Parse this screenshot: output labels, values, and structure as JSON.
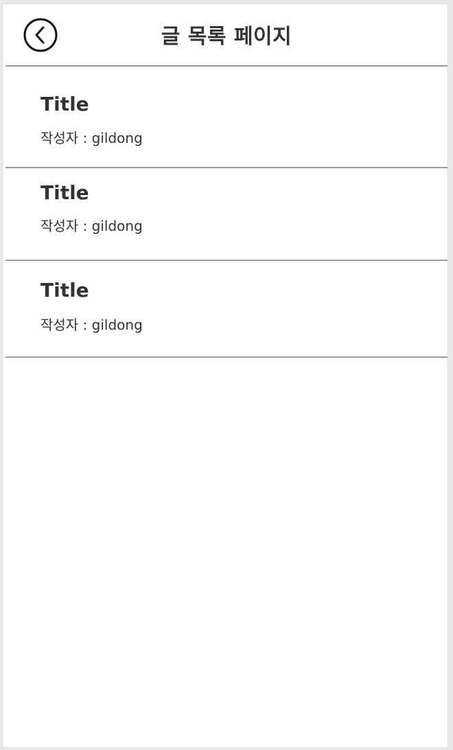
{
  "header": {
    "title": "글 목록 페이지",
    "back_icon": "chevron-left-circle-icon"
  },
  "posts": [
    {
      "title": "Title",
      "author": "작성자 : gildong"
    },
    {
      "title": "Title",
      "author": "작성자 : gildong"
    },
    {
      "title": "Title",
      "author": "작성자 : gildong"
    }
  ],
  "colors": {
    "text": "#333333",
    "divider": "#9a9a9a",
    "background": "#ffffff"
  }
}
